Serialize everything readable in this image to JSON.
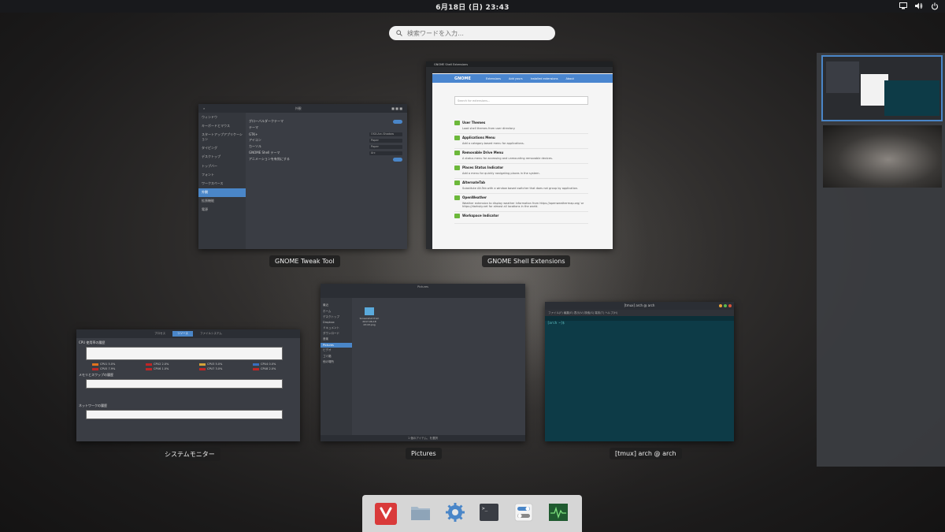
{
  "topbar": {
    "clock": "6月18日 (日) 23:43"
  },
  "search": {
    "placeholder": "検索ワードを入力…"
  },
  "windows": {
    "tweak": {
      "label": "GNOME Tweak Tool",
      "sidebar": [
        "ウィンドウ",
        "キーボードとマウス",
        "スタートアップアプリケーション",
        "タイピング",
        "デスクトップ",
        "トップバー",
        "フォント",
        "ワークスペース",
        "外観",
        "拡張機能",
        "電源"
      ],
      "selected_index": 8,
      "rows": [
        {
          "label": "グローバルダークテーマ",
          "value": ""
        },
        {
          "label": "テーマ",
          "value": ""
        },
        {
          "label": "GTK+",
          "value": "OSX-Arc-Shadow"
        },
        {
          "label": "アイコン",
          "value": "Paper"
        },
        {
          "label": "カーソル",
          "value": "Paper"
        },
        {
          "label": "GNOME Shell テーマ",
          "value": "Arc"
        },
        {
          "label": "アニメーションを有効にする",
          "value": ""
        }
      ]
    },
    "browser": {
      "label": "GNOME Shell Extensions",
      "tab_title": "GNOME Shell Extensions",
      "nav": [
        "Extensions",
        "Add yours",
        "Installed extensions",
        "About"
      ],
      "logo": "GNOME",
      "search_placeholder": "Search for extensions...",
      "extensions": [
        {
          "name": "User Themes",
          "desc": "Load shell themes from user directory."
        },
        {
          "name": "Applications Menu",
          "desc": "Add a category-based menu for applications."
        },
        {
          "name": "Removable Drive Menu",
          "desc": "A status menu for accessing and unmounting removable devices."
        },
        {
          "name": "Places Status Indicator",
          "desc": "Add a menu for quickly navigating places in the system."
        },
        {
          "name": "AlternateTab",
          "desc": "Substitute Alt-Tab with a window based switcher that does not group by application."
        },
        {
          "name": "OpenWeather",
          "desc": "Weather extension to display weather information from https://openweathermap.org/ or https://darksky.net for almost all locations in the world."
        },
        {
          "name": "Workspace Indicator",
          "desc": ""
        }
      ]
    },
    "files": {
      "label": "Pictures",
      "title": "Pictures",
      "sidebar": [
        "最近",
        "ホーム",
        "デスクトップ",
        "Dropbox",
        "ドキュメント",
        "ダウンロード",
        "音楽",
        "Pictures",
        "ビデオ",
        "ゴミ箱",
        "他の場所"
      ],
      "selected_index": 7,
      "file_name": "Screenshot from 2017-06-18 23:43.png",
      "status": "1 個のアイテム、を選択"
    },
    "terminal": {
      "label": "[tmux] arch @ arch",
      "title": "[tmux] arch @ arch",
      "menu": "ファイル(F)   編集(E)   表示(V)   検索(S)   端末(T)   ヘルプ(H)",
      "prompt": "[arch ~]$"
    },
    "sysmon": {
      "label": "システムモニター",
      "tabs": [
        "プロセス",
        "リソース",
        "ファイルシステム"
      ],
      "selected_tab": 1,
      "cpu_title": "CPU 使用率の履歴",
      "cpus": [
        {
          "name": "CPU1 5.0%",
          "color": "#e0731e"
        },
        {
          "name": "CPU2 2.0%",
          "color": "#c02626"
        },
        {
          "name": "CPU3 5.0%",
          "color": "#d4a43a"
        },
        {
          "name": "CPU4 0.0%",
          "color": "#3a6fbf"
        },
        {
          "name": "CPU5 7.9%",
          "color": "#c02626"
        },
        {
          "name": "CPU6 1.0%",
          "color": "#c02626"
        },
        {
          "name": "CPU7 3.0%",
          "color": "#c02626"
        },
        {
          "name": "CPU8 2.0%",
          "color": "#c02626"
        }
      ],
      "mem_title": "メモリとスワップの履歴",
      "net_title": "ネットワークの履歴"
    }
  },
  "dash": {
    "apps": [
      {
        "name": "Vivaldi",
        "icon": "vivaldi-icon",
        "color": "#d93a3a"
      },
      {
        "name": "Files",
        "icon": "folder-icon",
        "color": "#8ea4b8"
      },
      {
        "name": "Settings",
        "icon": "gear-icon",
        "color": "#4a86c8"
      },
      {
        "name": "Terminal",
        "icon": "terminal-icon",
        "color": "#3a3d44"
      },
      {
        "name": "Tweaks",
        "icon": "toggle-icon",
        "color": "#4a86c8"
      },
      {
        "name": "System Monitor",
        "icon": "monitor-icon",
        "color": "#1f5a2f"
      }
    ]
  }
}
